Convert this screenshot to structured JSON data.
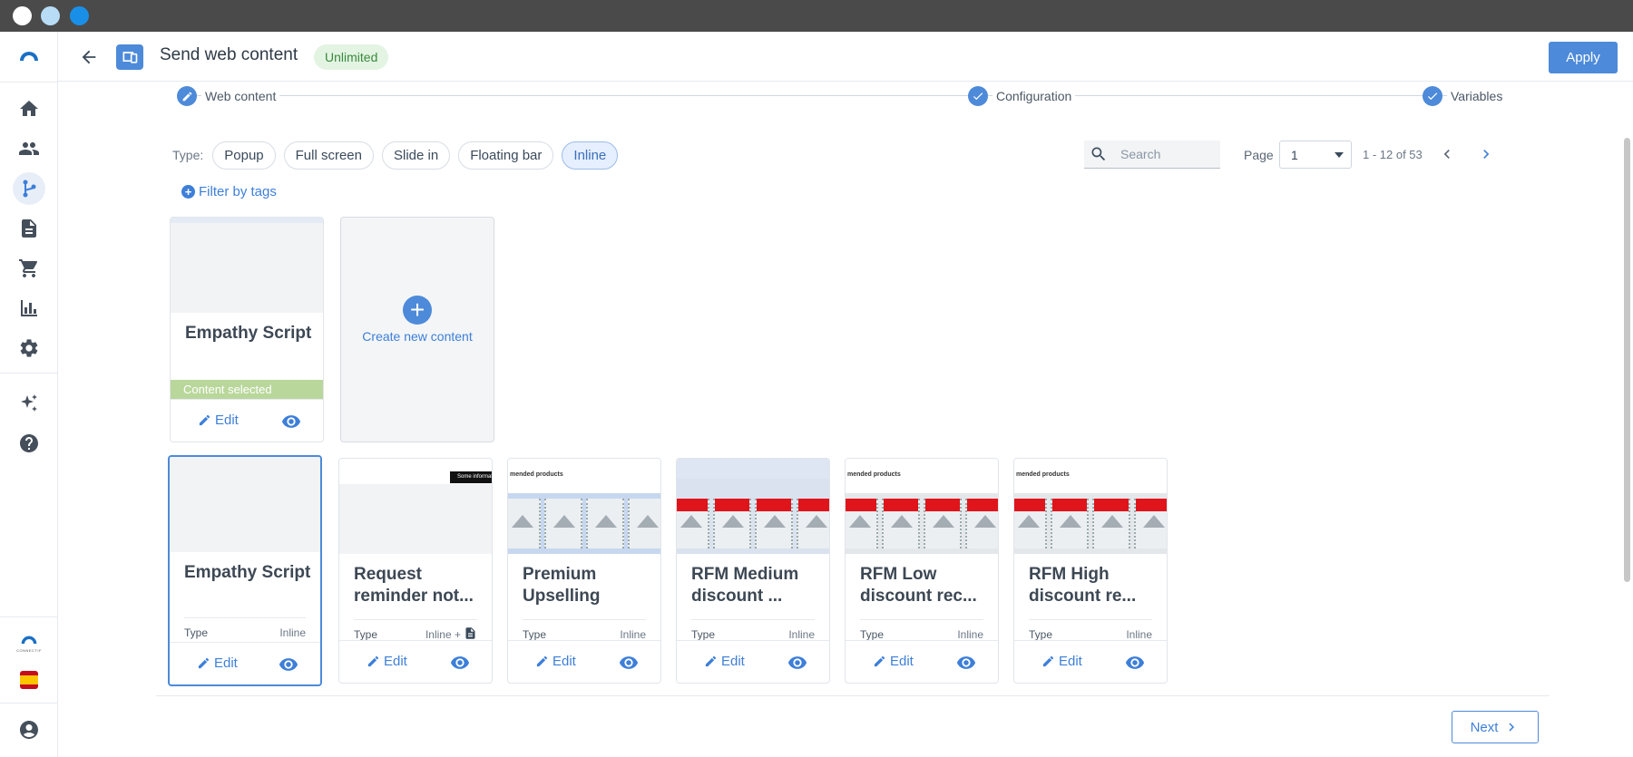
{
  "window": {
    "dots": [
      "#ffffff",
      "#b8dcf5",
      "#1a8fe8"
    ]
  },
  "sidebar": {
    "items": [
      {
        "name": "logo-icon",
        "active": false
      },
      {
        "name": "home-icon",
        "active": false
      },
      {
        "name": "contacts-icon",
        "active": false
      },
      {
        "name": "workflow-icon",
        "active": true
      },
      {
        "name": "document-icon",
        "active": false
      },
      {
        "name": "cart-icon",
        "active": false
      },
      {
        "name": "bar-chart-icon",
        "active": false
      },
      {
        "name": "gear-icon",
        "active": false
      },
      {
        "name": "sparkle-icon",
        "active": false
      },
      {
        "name": "help-icon",
        "active": false
      }
    ],
    "brand_label": "CONNECTIF",
    "language_flag": "spain-flag-icon",
    "account": "account-icon"
  },
  "header": {
    "title": "Send web content",
    "badge": "Unlimited",
    "apply_label": "Apply"
  },
  "stepper": {
    "steps": [
      {
        "label": "Web content",
        "icon": "pencil-icon"
      },
      {
        "label": "Configuration",
        "icon": "check-icon"
      },
      {
        "label": "Variables",
        "icon": "check-icon"
      }
    ]
  },
  "filters": {
    "type_label": "Type:",
    "types": [
      "Popup",
      "Full screen",
      "Slide in",
      "Floating bar",
      "Inline"
    ],
    "active_type": "Inline",
    "filter_by_tags": "Filter by tags"
  },
  "toolbar": {
    "search_placeholder": "Search",
    "page_label": "Page",
    "page_value": "1",
    "range": "1 - 12 of 53"
  },
  "selected_content": {
    "title": "Empathy Script",
    "status": "Content selected",
    "edit_label": "Edit"
  },
  "create_card": {
    "label": "Create new content"
  },
  "cards": [
    {
      "title": "Empathy Script",
      "type_label": "Type",
      "type_value": "Inline",
      "edit_label": "Edit"
    },
    {
      "title": "Request reminder not...",
      "type_label": "Type",
      "type_value": "Inline +",
      "edit_label": "Edit",
      "thumb_text": "Some informat"
    },
    {
      "title": "Premium Upselling",
      "type_label": "Type",
      "type_value": "Inline",
      "edit_label": "Edit",
      "thumb_text": "mended products"
    },
    {
      "title": "RFM Medium discount ...",
      "type_label": "Type",
      "type_value": "Inline",
      "edit_label": "Edit"
    },
    {
      "title": "RFM Low discount rec...",
      "type_label": "Type",
      "type_value": "Inline",
      "edit_label": "Edit",
      "thumb_text": "mended products"
    },
    {
      "title": "RFM High discount re...",
      "type_label": "Type",
      "type_value": "Inline",
      "edit_label": "Edit",
      "thumb_text": "mended products"
    }
  ],
  "footer": {
    "next_label": "Next"
  },
  "colors": {
    "accent": "#4d8ad9",
    "selected_bar": "#b9d79b",
    "badge_bg": "#e3f4e3",
    "thumb_red": "#e0141b"
  }
}
